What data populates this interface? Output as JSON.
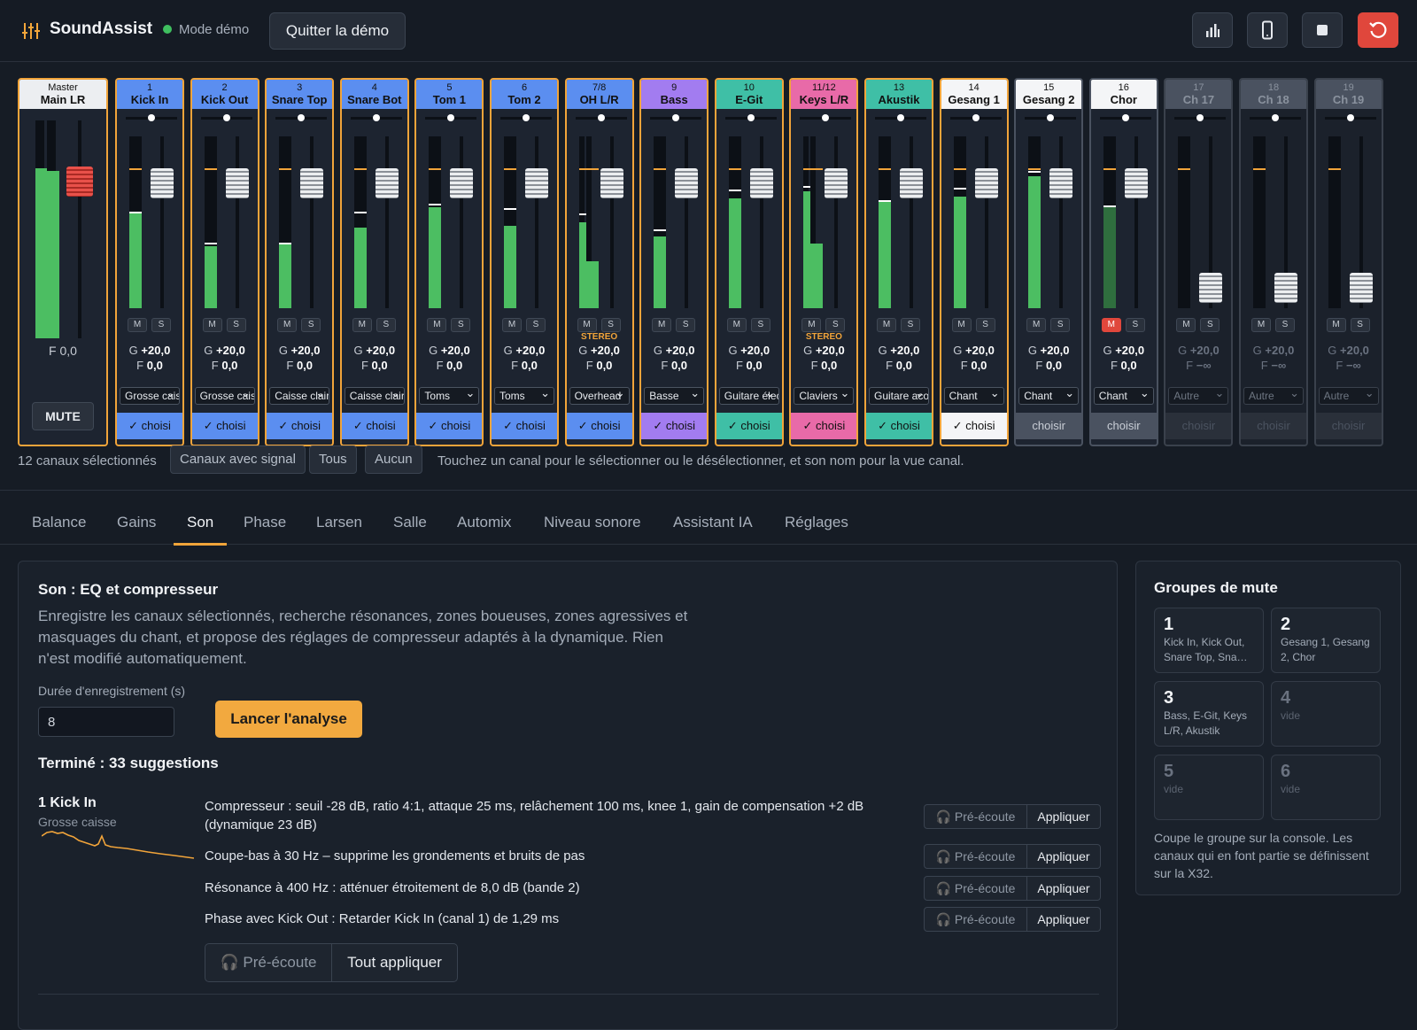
{
  "app": {
    "name": "SoundAssist",
    "mode": "Mode démo",
    "quit": "Quitter la démo"
  },
  "toolbar_icons": [
    "bar-chart-icon",
    "tablet-icon",
    "stop-icon",
    "reset-icon"
  ],
  "colors": {
    "accent": "#f2a93f",
    "danger": "#e0473c",
    "meter": "#4cbe62",
    "drums": "#5b8ef0",
    "bass": "#a27cf0",
    "guitar": "#3fbfa6",
    "keys": "#e86aa8",
    "vocals": "#f4f5f7",
    "inactive": "#4a5260"
  },
  "master": {
    "num": "Master",
    "name": "Main LR",
    "fader": "F 0,0",
    "mute": "MUTE",
    "level_l": 0.78,
    "level_r": 0.77
  },
  "channels": [
    {
      "num": "1",
      "name": "Kick In",
      "color": "#5b8ef0",
      "g": "+20,0",
      "f": "0,0",
      "type": "Grosse caisse",
      "choose": "✓ choisi",
      "selected": true,
      "level": 0.55,
      "peak": 0.55
    },
    {
      "num": "2",
      "name": "Kick Out",
      "color": "#5b8ef0",
      "g": "+20,0",
      "f": "0,0",
      "type": "Grosse caisse",
      "choose": "✓ choisi",
      "selected": true,
      "level": 0.36,
      "peak": 0.37
    },
    {
      "num": "3",
      "name": "Snare Top",
      "color": "#5b8ef0",
      "g": "+20,0",
      "f": "0,0",
      "type": "Caisse claire",
      "choose": "✓ choisi",
      "selected": true,
      "level": 0.37,
      "peak": 0.37
    },
    {
      "num": "4",
      "name": "Snare Bot",
      "color": "#5b8ef0",
      "g": "+20,0",
      "f": "0,0",
      "type": "Caisse claire",
      "choose": "✓ choisi",
      "selected": true,
      "level": 0.47,
      "peak": 0.55
    },
    {
      "num": "5",
      "name": "Tom 1",
      "color": "#5b8ef0",
      "g": "+20,0",
      "f": "0,0",
      "type": "Toms",
      "choose": "✓ choisi",
      "selected": true,
      "level": 0.59,
      "peak": 0.6
    },
    {
      "num": "6",
      "name": "Tom 2",
      "color": "#5b8ef0",
      "g": "+20,0",
      "f": "0,0",
      "type": "Toms",
      "choose": "✓ choisi",
      "selected": true,
      "level": 0.48,
      "peak": 0.57
    },
    {
      "num": "7/8",
      "name": "OH L/R",
      "color": "#5b8ef0",
      "g": "+20,0",
      "f": "0,0",
      "type": "Overhead",
      "choose": "✓ choisi",
      "selected": true,
      "level": 0.5,
      "peak": 0.54,
      "stereo": "STEREO"
    },
    {
      "num": "9",
      "name": "Bass",
      "color": "#a27cf0",
      "g": "+20,0",
      "f": "0,0",
      "type": "Basse",
      "choose": "✓ choisi",
      "selected": true,
      "level": 0.42,
      "peak": 0.45
    },
    {
      "num": "10",
      "name": "E-Git",
      "color": "#3fbfa6",
      "g": "+20,0",
      "f": "0,0",
      "type": "Guitare électrique",
      "choose": "✓ choisi",
      "selected": true,
      "level": 0.64,
      "peak": 0.68
    },
    {
      "num": "11/12",
      "name": "Keys L/R",
      "color": "#e86aa8",
      "g": "+20,0",
      "f": "0,0",
      "type": "Claviers",
      "choose": "✓ choisi",
      "selected": true,
      "level": 0.68,
      "peak": 0.7,
      "stereo": "STEREO"
    },
    {
      "num": "13",
      "name": "Akustik",
      "color": "#3fbfa6",
      "g": "+20,0",
      "f": "0,0",
      "type": "Guitare acoustique",
      "choose": "✓ choisi",
      "selected": true,
      "level": 0.62,
      "peak": 0.62
    },
    {
      "num": "14",
      "name": "Gesang 1",
      "color": "#f4f5f7",
      "g": "+20,0",
      "f": "0,0",
      "type": "Chant",
      "choose": "✓ choisi",
      "selected": true,
      "level": 0.65,
      "peak": 0.69
    },
    {
      "num": "15",
      "name": "Gesang 2",
      "color": "#f4f5f7",
      "g": "+20,0",
      "f": "0,0",
      "type": "Chant",
      "choose": "choisir",
      "selected": false,
      "level": 0.77,
      "peak": 0.79
    },
    {
      "num": "16",
      "name": "Chor",
      "color": "#f4f5f7",
      "g": "+20,0",
      "f": "0,0",
      "type": "Chant",
      "choose": "choisir",
      "selected": false,
      "level": 0.59,
      "peak": 0.59,
      "muted": true
    },
    {
      "num": "17",
      "name": "Ch 17",
      "color": "#4a5260",
      "g": "+20,0",
      "f": "−∞",
      "type": "Autre",
      "choose": "choisir",
      "selected": false,
      "inactive": true,
      "level": 0,
      "peak": 0
    },
    {
      "num": "18",
      "name": "Ch 18",
      "color": "#4a5260",
      "g": "+20,0",
      "f": "−∞",
      "type": "Autre",
      "choose": "choisir",
      "selected": false,
      "inactive": true,
      "level": 0,
      "peak": 0
    },
    {
      "num": "19",
      "name": "Ch 19",
      "color": "#4a5260",
      "g": "+20,0",
      "f": "−∞",
      "type": "Autre",
      "choose": "choisir",
      "selected": false,
      "inactive": true,
      "level": 0,
      "peak": 0
    }
  ],
  "labels": {
    "m": "M",
    "s": "S",
    "g_prefix": "G",
    "f_prefix": "F"
  },
  "selection": {
    "count": "12 canaux sélectionnés",
    "with_signal": "Canaux avec signal",
    "all": "Tous",
    "none": "Aucun",
    "hint": "Touchez un canal pour le sélectionner ou le désélectionner, et son nom pour la vue canal."
  },
  "tabs": [
    "Balance",
    "Gains",
    "Son",
    "Phase",
    "Larsen",
    "Salle",
    "Automix",
    "Niveau sonore",
    "Assistant IA",
    "Réglages"
  ],
  "active_tab": "Son",
  "son": {
    "title": "Son : EQ et compresseur",
    "desc": "Enregistre les canaux sélectionnés, recherche résonances, zones boueuses, zones agressives et masquages du chant, et propose des réglages de compresseur adaptés à la dynamique. Rien n'est modifié automatiquement.",
    "duration_label": "Durée d'enregistrement (s)",
    "duration_value": "8",
    "launch": "Lancer l'analyse",
    "done": "Terminé : 33 suggestions",
    "channel": {
      "name": "1 Kick In",
      "type": "Grosse caisse"
    },
    "suggestions": [
      "Compresseur : seuil -28 dB, ratio 4:1, attaque 25 ms, relâchement 100 ms, knee 1, gain de compensation +2 dB (dynamique 23 dB)",
      "Coupe-bas à 30 Hz – supprime les grondements et bruits de pas",
      "Résonance à 400 Hz : atténuer étroitement de 8,0 dB (bande 2)",
      "Phase avec Kick Out : Retarder Kick In (canal 1) de 1,29 ms"
    ],
    "preview": "Pré-écoute",
    "apply": "Appliquer",
    "apply_all": "Tout appliquer"
  },
  "mute_groups": {
    "title": "Groupes de mute",
    "groups": [
      {
        "n": "1",
        "members": "Kick In, Kick Out, Snare Top, Sna…"
      },
      {
        "n": "2",
        "members": "Gesang 1, Gesang 2, Chor"
      },
      {
        "n": "3",
        "members": "Bass, E-Git, Keys L/R, Akustik"
      },
      {
        "n": "4",
        "members": "vide"
      },
      {
        "n": "5",
        "members": "vide"
      },
      {
        "n": "6",
        "members": "vide"
      }
    ],
    "note": "Coupe le groupe sur la console. Les canaux qui en font partie se définissent sur la X32."
  }
}
